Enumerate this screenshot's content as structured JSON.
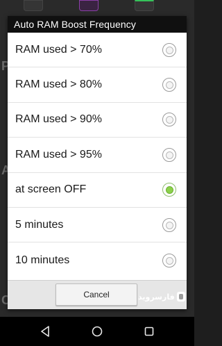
{
  "background": {
    "letters": [
      "P",
      "A",
      "C"
    ]
  },
  "dialog": {
    "title": "Auto RAM Boost Frequency",
    "options": [
      {
        "label": "RAM used > 70%",
        "checked": false
      },
      {
        "label": "RAM used > 80%",
        "checked": false
      },
      {
        "label": "RAM used > 90%",
        "checked": false
      },
      {
        "label": "RAM used > 95%",
        "checked": false
      },
      {
        "label": "at screen OFF",
        "checked": true
      },
      {
        "label": "5 minutes",
        "checked": false
      },
      {
        "label": "10 minutes",
        "checked": false
      }
    ],
    "cancel_label": "Cancel"
  },
  "watermark": {
    "text": "فارسروید"
  },
  "navbar": {
    "icons": [
      "back-icon",
      "home-icon",
      "recents-icon"
    ]
  },
  "colors": {
    "title_bar": "#101010",
    "checked_radio": "#8bd24a",
    "footer": "#e6e6e6"
  }
}
